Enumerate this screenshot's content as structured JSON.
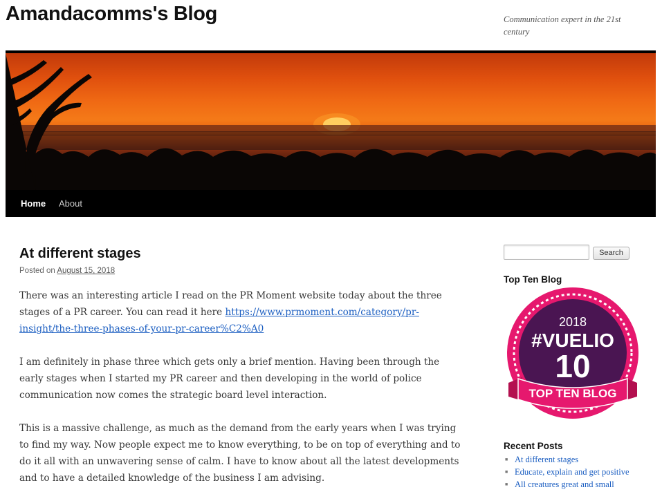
{
  "site": {
    "title": "Amandacomms's Blog",
    "tagline": "Communication expert in the 21st century"
  },
  "nav": {
    "home": "Home",
    "about": "About"
  },
  "post": {
    "title": "At different stages",
    "posted_on": "Posted on",
    "date": "August 15, 2018",
    "p1_text": "There was an interesting article I read on the PR Moment website today about the three stages of a PR career. You can read it here ",
    "p1_link": "https://www.prmoment.com/category/pr-insight/the-three-phases-of-your-pr-career%C2%A0",
    "p2": "I am definitely in phase three which gets only a brief mention. Having been through the early stages when I started my PR career and then developing in the world of police communication now comes the strategic board level interaction.",
    "p3": "This is a massive challenge, as much as the demand from the early years when I was trying to find my way. Now people expect me to know everything, to be on top of everything and to do it all with an unwavering sense of calm. I have to know about all the latest developments and to have a detailed knowledge of the business I am advising."
  },
  "sidebar": {
    "search_button": "Search",
    "top_ten_title": "Top Ten Blog",
    "badge": {
      "year": "2018",
      "brand": "#VUELIO",
      "number": "10",
      "ribbon": "TOP TEN BLOG"
    },
    "recent_title": "Recent Posts",
    "recent_posts": [
      "At different stages",
      "Educate, explain and get positive",
      "All creatures great and small"
    ]
  },
  "colors": {
    "link": "#1b5ec1",
    "badge_pink": "#e6186e",
    "badge_purple": "#4a1552"
  }
}
